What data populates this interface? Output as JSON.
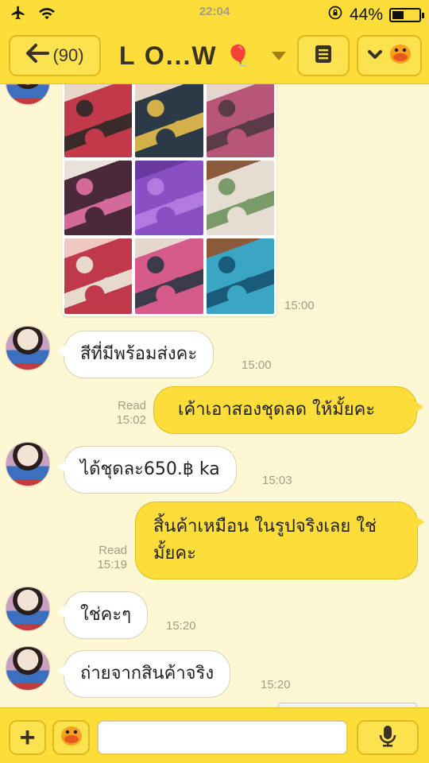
{
  "status_bar": {
    "time": "22:04",
    "battery_percent": "44%",
    "battery_level": 0.44
  },
  "header": {
    "back_count": "(90)",
    "title": "L O...W",
    "title_emoji": "🎈"
  },
  "messages": [
    {
      "side": "in",
      "type": "image",
      "time": "15:00"
    },
    {
      "side": "in",
      "text": "สีที่มีพร้อมส่งคะ",
      "time": "15:00"
    },
    {
      "side": "out",
      "text": "เค้าเอาสองชุดลด ให้มั้ยคะ",
      "status": "Read",
      "time": "15:02"
    },
    {
      "side": "in",
      "text": "ได้ชุดละ650.฿ ka",
      "time": "15:03"
    },
    {
      "side": "out",
      "text": "สิ้นค้าเหมือน ในรูปจริงเลย ใช่มั้ยคะ",
      "text_line1": "สิ้นค้าเหมือน ในรูปจริงเลย ใช่",
      "text_line2": "มั้ยคะ",
      "status": "Read",
      "time": "15:19"
    },
    {
      "side": "in",
      "text": "ใช่คะๆ",
      "time": "15:20"
    },
    {
      "side": "in",
      "text": "ถ่ายจากสินค้าจริง",
      "time": "15:20"
    }
  ],
  "photos": [
    {
      "colors": [
        "#c23a4a",
        "#3a2a2a",
        "#e7d7c9"
      ]
    },
    {
      "colors": [
        "#2c3a48",
        "#d4b04a",
        "#e7d7c9"
      ]
    },
    {
      "colors": [
        "#b8567a",
        "#5a3a48",
        "#e4d6cf"
      ]
    },
    {
      "colors": [
        "#4a2a3a",
        "#d46a9a",
        "#e9e2da"
      ]
    },
    {
      "colors": [
        "#8b4fc4",
        "#b27ae0",
        "#6a3aa0"
      ]
    },
    {
      "colors": [
        "#e6ddd2",
        "#7a9a6a",
        "#8a5a3a"
      ]
    },
    {
      "colors": [
        "#c0394a",
        "#e7dacd",
        "#f0c8c0"
      ]
    },
    {
      "colors": [
        "#d65a8a",
        "#3a3a4a",
        "#e6d7cf"
      ]
    },
    {
      "colors": [
        "#3aa6c4",
        "#1a5a7a",
        "#8a5a3a"
      ]
    }
  ],
  "composer": {
    "placeholder": ""
  },
  "colors": {
    "header_yellow": "#fddd3a",
    "chat_bg": "#fdf7d3",
    "incoming_bubble": "#ffffff",
    "outgoing_bubble": "#fddd3a",
    "timestamp": "#a39d85"
  }
}
